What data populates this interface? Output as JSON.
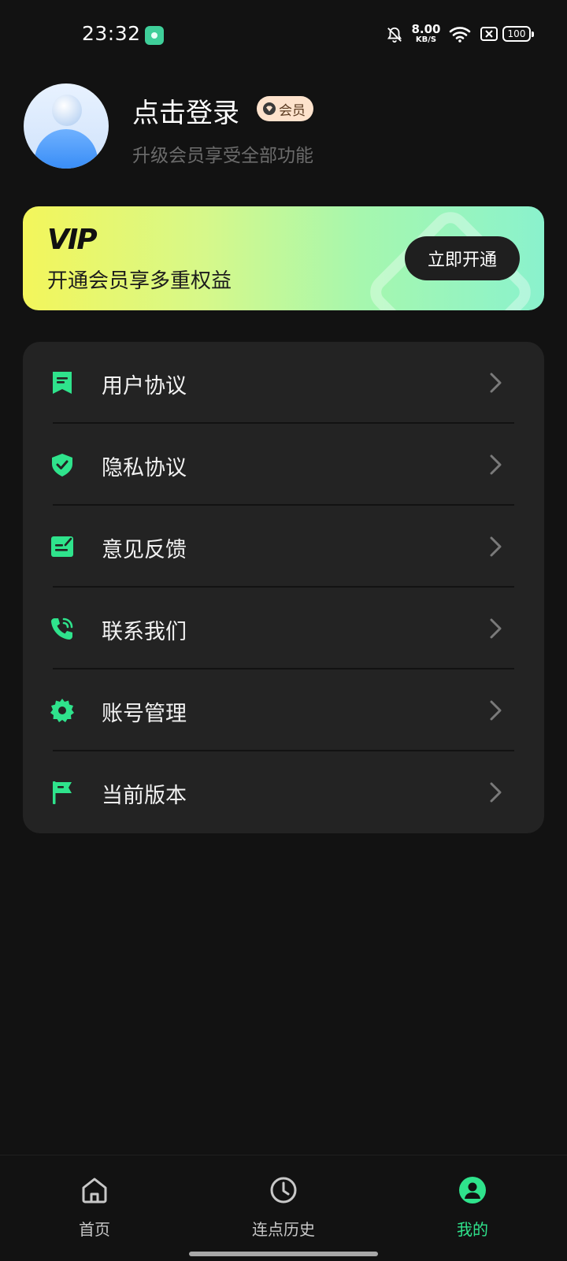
{
  "status_bar": {
    "time": "23:32",
    "net_speed_value": "8.00",
    "net_speed_unit": "KB/S",
    "battery": "100",
    "icons": [
      "app-notification-icon",
      "bell-muted-icon",
      "wifi-icon",
      "sim-disabled-icon",
      "battery-icon"
    ]
  },
  "profile": {
    "title": "点击登录",
    "badge": "会员",
    "subtitle": "升级会员享受全部功能"
  },
  "vip_banner": {
    "logo": "VIP",
    "text": "开通会员享多重权益",
    "button": "立即开通"
  },
  "menu": {
    "items": [
      {
        "label": "用户协议",
        "icon": "bookmark-doc-icon"
      },
      {
        "label": "隐私协议",
        "icon": "shield-check-icon"
      },
      {
        "label": "意见反馈",
        "icon": "feedback-edit-icon"
      },
      {
        "label": "联系我们",
        "icon": "phone-call-icon"
      },
      {
        "label": "账号管理",
        "icon": "gear-icon"
      },
      {
        "label": "当前版本",
        "icon": "flag-icon"
      }
    ]
  },
  "bottom_nav": {
    "items": [
      {
        "label": "首页",
        "icon": "home-icon"
      },
      {
        "label": "连点历史",
        "icon": "clock-icon"
      },
      {
        "label": "我的",
        "icon": "profile-icon",
        "active": true
      }
    ]
  },
  "colors": {
    "accent": "#2fe38c",
    "background": "#121212",
    "card": "#232323"
  }
}
